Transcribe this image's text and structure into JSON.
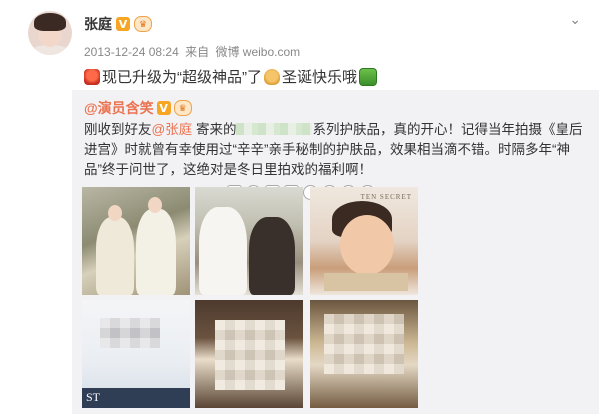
{
  "post": {
    "author": "张庭",
    "verified_badge": "V",
    "vip_badge": "♛",
    "timestamp": "2013-12-24 08:24",
    "source_prefix": "来自",
    "source": "微博 weibo.com",
    "menu_icon": "chevron-down-icon",
    "text_parts": [
      "现已升级为“超级神品”了",
      "圣诞快乐哦"
    ]
  },
  "repost": {
    "author": "@演员含笑",
    "verified_badge": "V",
    "vip_badge": "♛",
    "text_1": "刚收到好友",
    "mention": "@张庭",
    "text_2": " 寄来的",
    "text_3": "系列护肤品，真的开心！记得当年拍摄《皇后进宫》时就曾有幸使用过“辛辛”亲手秘制的护肤品，效果相当滴不错。时隔多年“神品”终于问世了，这绝对是冬日里拍戏的福利啊！",
    "emoji_icons": [
      "gift-icon",
      "bell-icon",
      "candle-icon",
      "candle-icon",
      "tree-icon",
      "tree-icon",
      "clap-icon",
      "clap-icon"
    ],
    "images": [
      {
        "name": "costume-photo-1"
      },
      {
        "name": "costume-photo-2"
      },
      {
        "name": "product-ad-photo",
        "brand_text": "TEN SECRET"
      },
      {
        "name": "product-box-photo",
        "box_text": "ST"
      },
      {
        "name": "product-photo-2"
      },
      {
        "name": "product-photo-3"
      }
    ]
  }
}
